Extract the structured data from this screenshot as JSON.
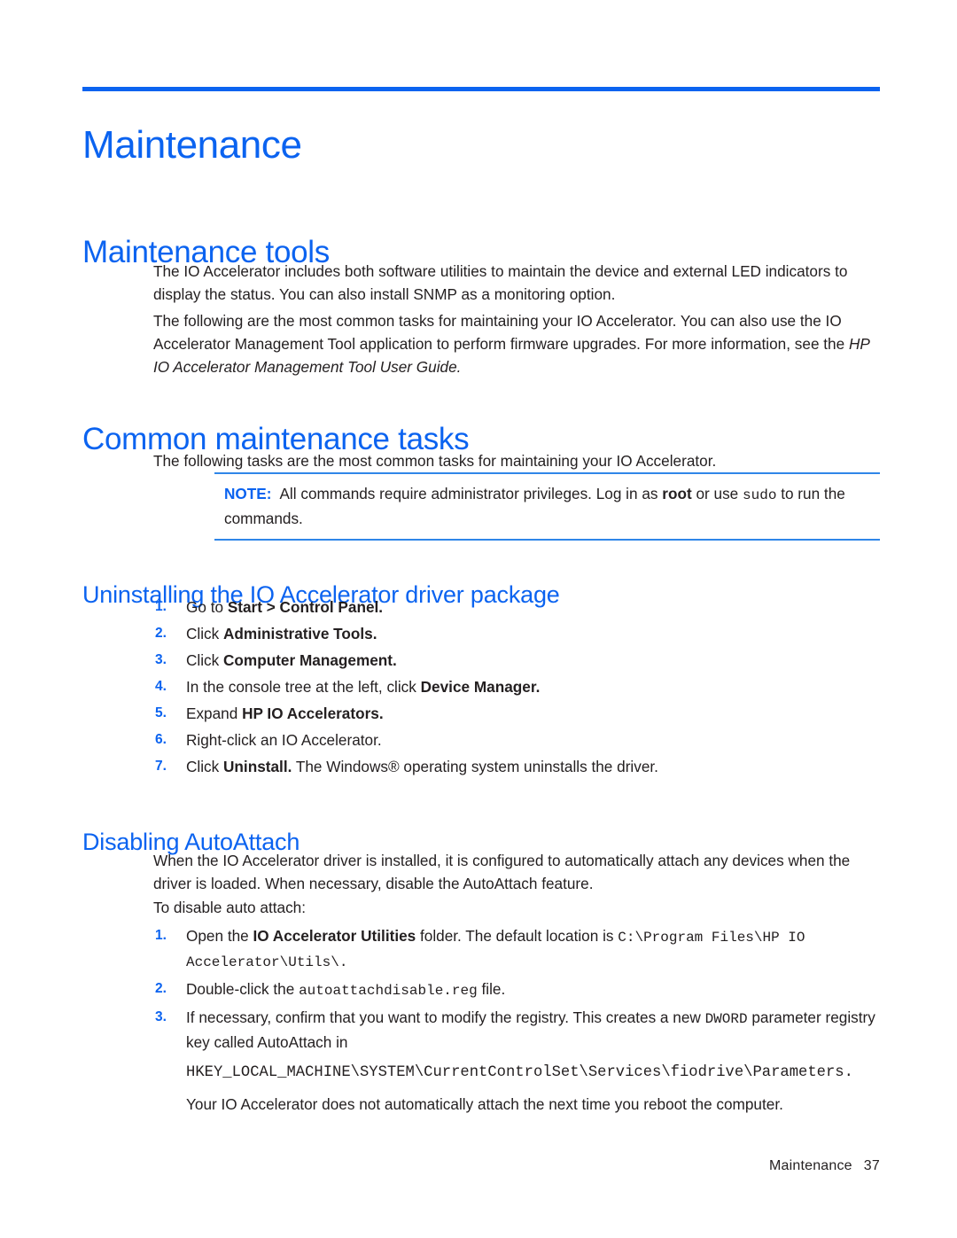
{
  "page": {
    "chapter_title": "Maintenance",
    "footer_label": "Maintenance",
    "footer_page": "37",
    "accent_color": "#0b63f0",
    "note_rule_color": "#2f86e8",
    "body_color": "#231f20"
  },
  "sections": {
    "maintenance_tools": {
      "heading": "Maintenance tools",
      "paragraph_1": "The IO Accelerator includes both software utilities to maintain the device and external LED indicators to display the status. You can also install SNMP as a monitoring option.",
      "paragraph_2_part1": "The following are the most common tasks for maintaining your IO Accelerator. You can also use the IO Accelerator Management Tool application to perform firmware upgrades. For more information, see the ",
      "paragraph_2_italic": "HP IO Accelerator Management Tool User Guide."
    },
    "common_tasks": {
      "heading": "Common maintenance tasks",
      "paragraph_1": "The following tasks are the most common tasks for maintaining your IO Accelerator.",
      "note": {
        "label": "NOTE:",
        "text_part1": "All commands require administrator privileges. Log in as ",
        "bold_root": "root",
        "text_part2": " or use ",
        "mono_sudo": "sudo",
        "text_part3": " to run the commands."
      }
    },
    "uninstalling": {
      "heading": "Uninstalling the IO Accelerator driver package",
      "steps": [
        {
          "number": "1.",
          "text_part1": "Go to ",
          "bold": "Start > Control Panel.",
          "text_part2": ""
        },
        {
          "number": "2.",
          "text_part1": "Click ",
          "bold": "Administrative Tools.",
          "text_part2": ""
        },
        {
          "number": "3.",
          "text_part1": "Click ",
          "bold": "Computer Management.",
          "text_part2": ""
        },
        {
          "number": "4.",
          "text_part1": "In the console tree at the left, click ",
          "bold": "Device Manager.",
          "text_part2": ""
        },
        {
          "number": "5.",
          "text_part1": "Expand ",
          "bold": "HP IO Accelerators.",
          "text_part2": ""
        },
        {
          "number": "6.",
          "text_part1": "Right-click an IO Accelerator.",
          "bold": "",
          "text_part2": ""
        },
        {
          "number": "7.",
          "text_part1": "Click ",
          "bold": "Uninstall.",
          "text_part2": " The Windows® operating system uninstalls the driver."
        }
      ]
    },
    "disabling_autoattach": {
      "heading": "Disabling AutoAttach",
      "paragraph_1": "When the IO Accelerator driver is installed, it is configured to automatically attach any devices when the driver is loaded. When necessary, disable the AutoAttach feature.",
      "paragraph_2": "To disable auto attach:",
      "steps": [
        {
          "number": "1.",
          "text_part1": "Open the ",
          "bold": "IO Accelerator Utilities",
          "text_part2": " folder. The default location is ",
          "mono": "C:\\Program Files\\HP IO Accelerator\\Utils\\.",
          "text_part3": ""
        },
        {
          "number": "2.",
          "text_part1": "Double-click the ",
          "bold": "",
          "text_part2": "",
          "mono": "autoattachdisable.reg",
          "text_part3": " file."
        },
        {
          "number": "3.",
          "text_part1": "If necessary, confirm that you want to modify the registry. This creates a new ",
          "bold": "",
          "text_part2": "",
          "mono": "DWORD",
          "text_part3": " parameter registry key called AutoAttach in",
          "mono_line": "HKEY_LOCAL_MACHINE\\SYSTEM\\CurrentControlSet\\Services\\fiodrive\\Parameters.",
          "trailing": "Your IO Accelerator does not automatically attach the next time you reboot the computer."
        }
      ]
    }
  }
}
